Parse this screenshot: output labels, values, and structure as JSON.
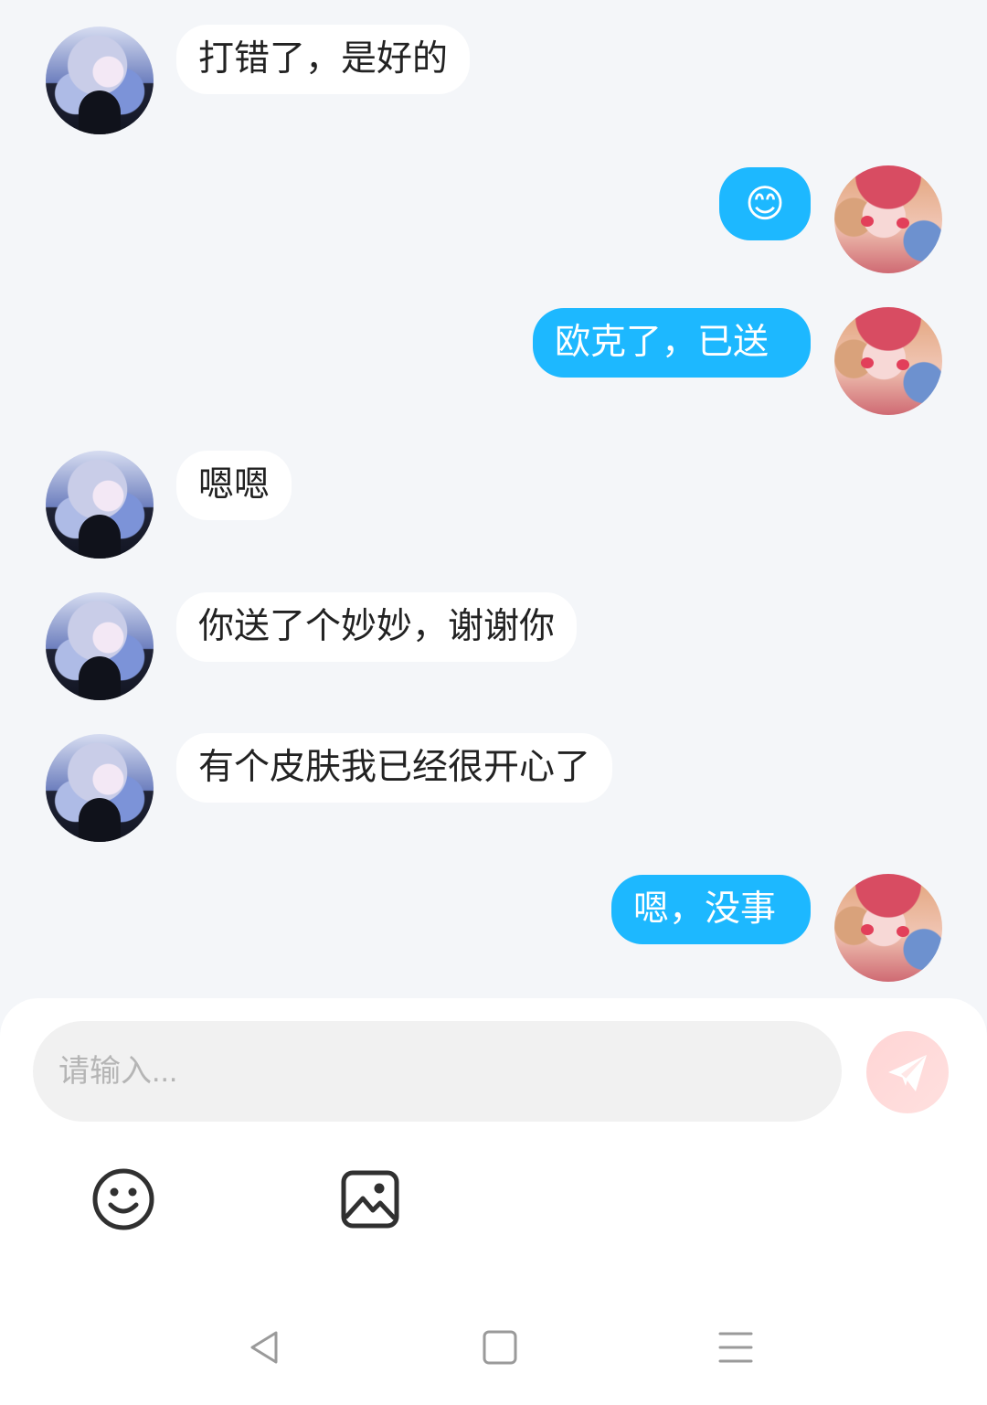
{
  "messages": [
    {
      "side": "left",
      "text": "打错了，是好的"
    },
    {
      "side": "right",
      "text": "😊"
    },
    {
      "side": "right",
      "text": "欧克了，已送"
    },
    {
      "side": "left",
      "text": "嗯嗯"
    },
    {
      "side": "left",
      "text": "你送了个妙妙，谢谢你"
    },
    {
      "side": "left",
      "text": "有个皮肤我已经很开心了"
    },
    {
      "side": "right",
      "text": "嗯，没事"
    }
  ],
  "composer": {
    "placeholder": "请输入...",
    "send_icon": "paper-plane-icon",
    "send_color": "#ffd7d6",
    "tools": [
      {
        "name": "emoji",
        "icon": "smile-icon"
      },
      {
        "name": "image",
        "icon": "image-icon"
      }
    ]
  },
  "navigation": {
    "back_icon": "triangle-back-icon",
    "home_icon": "square-home-icon",
    "menu_icon": "hamburger-menu-icon"
  },
  "colors": {
    "background": "#f4f6f9",
    "incoming_bubble": "#ffffff",
    "outgoing_bubble": "#1db8ff",
    "text": "#222222"
  }
}
